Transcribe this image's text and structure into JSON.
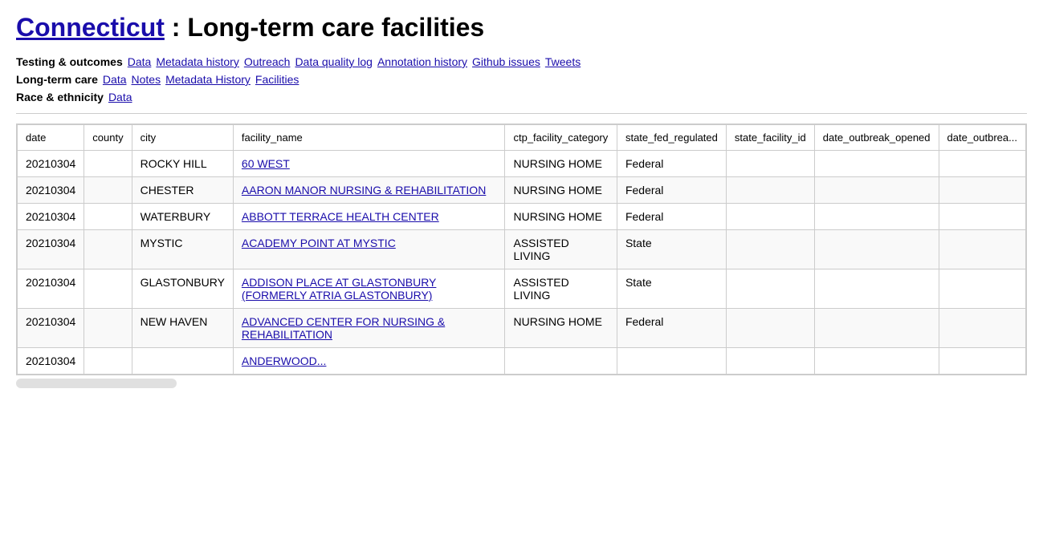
{
  "header": {
    "state_link": "Connecticut",
    "title": ": Long-term care facilities"
  },
  "nav": {
    "testing_outcomes": {
      "label": "Testing & outcomes",
      "links": [
        "Data",
        "Metadata history",
        "Outreach",
        "Data quality log",
        "Annotation history",
        "Github issues",
        "Tweets"
      ]
    },
    "long_term_care": {
      "label": "Long-term care",
      "links": [
        "Data",
        "Notes",
        "Metadata History",
        "Facilities"
      ]
    },
    "race_ethnicity": {
      "label": "Race & ethnicity",
      "links": [
        "Data"
      ]
    }
  },
  "table": {
    "columns": [
      "date",
      "county",
      "city",
      "facility_name",
      "ctp_facility_category",
      "state_fed_regulated",
      "state_facility_id",
      "date_outbreak_opened",
      "date_outbrea..."
    ],
    "rows": [
      {
        "date": "20210304",
        "county": "",
        "city": "ROCKY HILL",
        "facility_name": "60 WEST",
        "facility_name_link": true,
        "ctp_facility_category": "NURSING HOME",
        "state_fed_regulated": "Federal",
        "state_facility_id": "",
        "date_outbreak_opened": "",
        "date_outbreak_": ""
      },
      {
        "date": "20210304",
        "county": "",
        "city": "CHESTER",
        "facility_name": "AARON MANOR NURSING & REHABILITATION",
        "facility_name_link": true,
        "ctp_facility_category": "NURSING HOME",
        "state_fed_regulated": "Federal",
        "state_facility_id": "",
        "date_outbreak_opened": "",
        "date_outbreak_": ""
      },
      {
        "date": "20210304",
        "county": "",
        "city": "WATERBURY",
        "facility_name": "ABBOTT TERRACE HEALTH CENTER",
        "facility_name_link": true,
        "ctp_facility_category": "NURSING HOME",
        "state_fed_regulated": "Federal",
        "state_facility_id": "",
        "date_outbreak_opened": "",
        "date_outbreak_": ""
      },
      {
        "date": "20210304",
        "county": "",
        "city": "MYSTIC",
        "facility_name": "ACADEMY POINT AT MYSTIC",
        "facility_name_link": true,
        "ctp_facility_category": "ASSISTED LIVING",
        "state_fed_regulated": "State",
        "state_facility_id": "",
        "date_outbreak_opened": "",
        "date_outbreak_": ""
      },
      {
        "date": "20210304",
        "county": "",
        "city": "GLASTONBURY",
        "facility_name": "ADDISON PLACE AT GLASTONBURY (FORMERLY ATRIA GLASTONBURY)",
        "facility_name_link": true,
        "ctp_facility_category": "ASSISTED LIVING",
        "state_fed_regulated": "State",
        "state_facility_id": "",
        "date_outbreak_opened": "",
        "date_outbreak_": ""
      },
      {
        "date": "20210304",
        "county": "",
        "city": "NEW HAVEN",
        "facility_name": "ADVANCED CENTER FOR NURSING & REHABILITATION",
        "facility_name_link": true,
        "ctp_facility_category": "NURSING HOME",
        "state_fed_regulated": "Federal",
        "state_facility_id": "",
        "date_outbreak_opened": "",
        "date_outbreak_": ""
      },
      {
        "date": "20210304",
        "county": "",
        "city": "",
        "facility_name": "ANDERWOOD...",
        "facility_name_link": true,
        "ctp_facility_category": "",
        "state_fed_regulated": "",
        "state_facility_id": "",
        "date_outbreak_opened": "",
        "date_outbreak_": ""
      }
    ]
  }
}
